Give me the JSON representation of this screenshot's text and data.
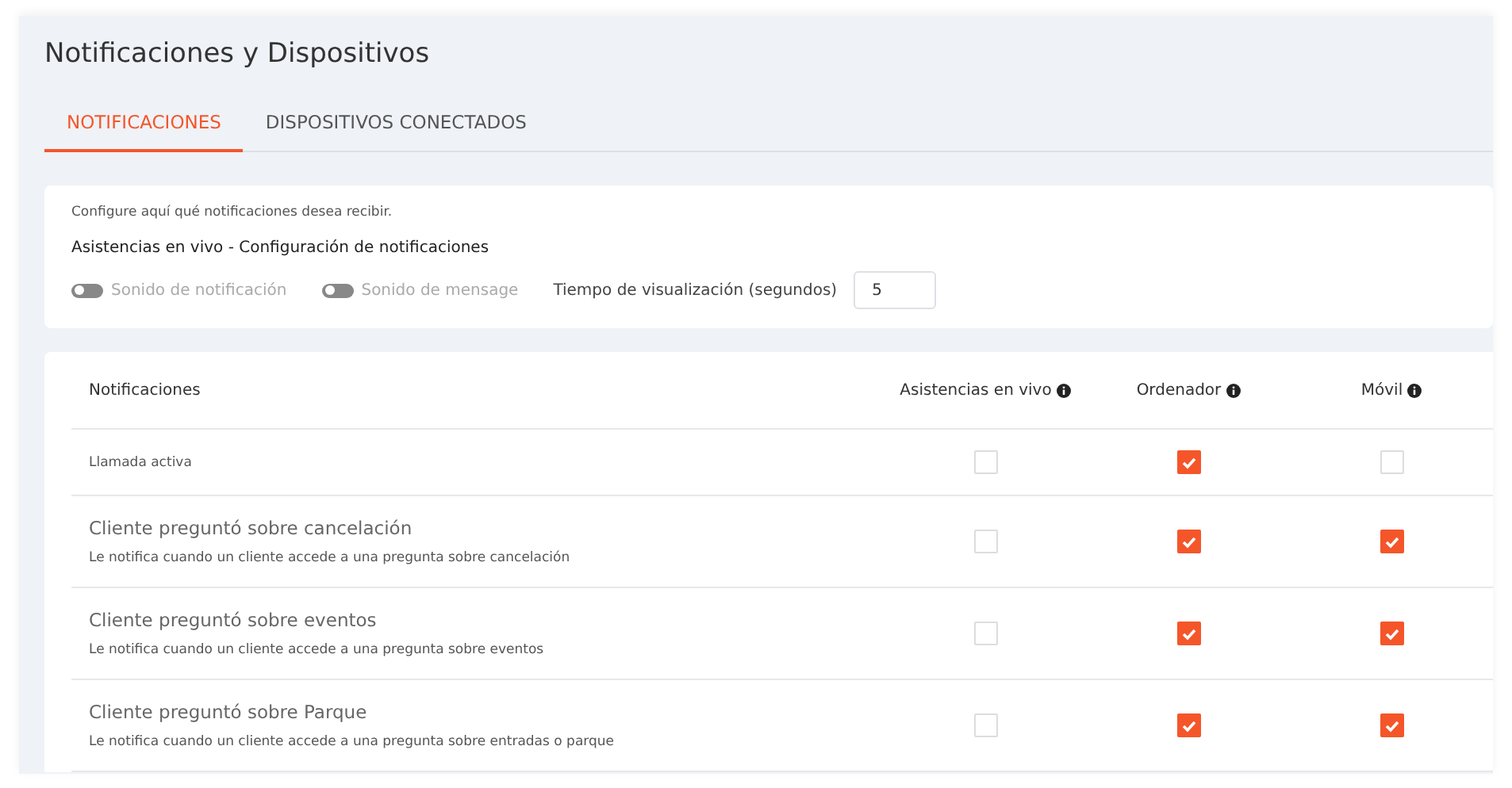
{
  "page": {
    "title": "Notificaciones y Dispositivos"
  },
  "tabs": [
    {
      "label": "NOTIFICACIONES",
      "selected": true
    },
    {
      "label": "DISPOSITIVOS CONECTADOS",
      "selected": false
    }
  ],
  "settings": {
    "intro": "Configure aquí qué notificaciones desea recibir.",
    "heading": "Asistencias en vivo - Configuración de notificaciones",
    "toggles": [
      {
        "label": "Sonido de notificación",
        "on": false
      },
      {
        "label": "Sonido de mensage",
        "on": false
      }
    ],
    "display_time": {
      "label": "Tiempo de visualización (segundos)",
      "value": "5"
    }
  },
  "table": {
    "columns": [
      "Notificaciones",
      "Asistencias en vivo",
      "Ordenador",
      "Móvil"
    ],
    "rows": [
      {
        "kind": "simple",
        "title": "Llamada activa",
        "checks": [
          false,
          true,
          false
        ]
      },
      {
        "kind": "detailed",
        "title": "Cliente preguntó sobre cancelación",
        "description": "Le notifica cuando un cliente accede a una pregunta sobre cancelación",
        "checks": [
          false,
          true,
          true
        ]
      },
      {
        "kind": "detailed",
        "title": "Cliente preguntó sobre eventos",
        "description": "Le notifica cuando un cliente accede a una pregunta sobre eventos",
        "checks": [
          false,
          true,
          true
        ]
      },
      {
        "kind": "detailed",
        "title": "Cliente preguntó sobre Parque",
        "description": "Le notifica cuando un cliente accede a una pregunta sobre entradas o parque",
        "checks": [
          false,
          true,
          true
        ]
      }
    ]
  }
}
